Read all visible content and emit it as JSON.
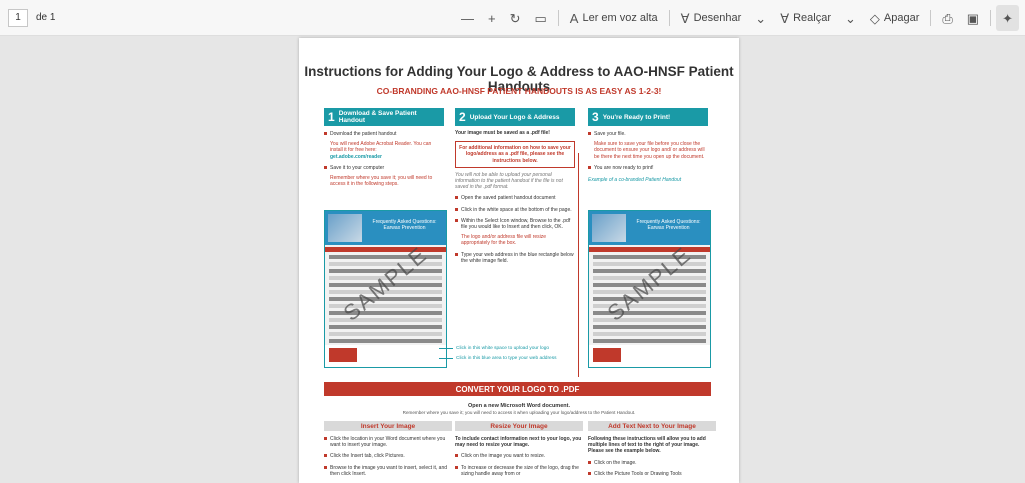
{
  "toolbar": {
    "page_number": "1",
    "page_of": "de 1",
    "read_aloud": "Ler em voz alta",
    "draw": "Desenhar",
    "highlight": "Realçar",
    "erase": "Apagar",
    "icons": [
      "zoom-out-icon",
      "zoom-in-icon",
      "rotate-icon",
      "fit-page-icon",
      "read-aloud-icon",
      "draw-icon",
      "chevron-down-icon",
      "highlight-icon",
      "eraser-icon",
      "print-icon",
      "save-icon",
      "pin-icon"
    ]
  },
  "document": {
    "title": "Instructions for Adding Your Logo & Address to AAO-HNSF Patient Handouts",
    "subtitle": "CO-BRANDING AAO-HNSF PATIENT HANDOUTS IS AS EASY AS 1-2-3!",
    "step1": {
      "num": "1",
      "title": "Download & Save Patient Handout",
      "b1": "Download the patient handout",
      "r1": "You will need Adobe Acrobat Reader. You can install it for free here:",
      "link": "get.adobe.com/reader",
      "b2": "Save it to your computer",
      "r2": "Remember where you save it; you will need to access it in the following steps."
    },
    "step2": {
      "num": "2",
      "title": "Upload Your Logo & Address",
      "must": "Your image must be saved as a .pdf file!",
      "box": "For additional information on how to save your logo/address as a .pdf file, please see the instructions below.",
      "note": "You will not be able to upload your personal information to the patient handout if the file is not saved in the .pdf format.",
      "b1": "Open the saved patient handout document",
      "b2": "Click in the white space at the bottom of the page.",
      "b3": "Within the Select Icon window, Browse to the .pdf file you would like to Insert and then click, OK.",
      "r3": "The logo and/or address file will resize appropriately for the box.",
      "b4": "Type your web address in the blue rectangle below the white image field."
    },
    "step3": {
      "num": "3",
      "title": "You're Ready to Print!",
      "b1": "Save your file.",
      "r1": "Make sure to save your file before you close the document to ensure your logo and/ or address will be there the next time you open up the document.",
      "b2": "You are now ready to print!",
      "example": "Example of a co-branded Patient Handout"
    },
    "sample_mark": "SAMPLE",
    "sample_title": "Frequently Asked Questions: Earwax Prevention",
    "callout_logo": "Click in this white space to upload your logo",
    "callout_web": "Click in this blue area to type your web address",
    "convert": "CONVERT YOUR LOGO TO .PDF",
    "open_word": "Open a new Microsoft Word document.",
    "remember": "Remember where you save it; you will need to access it when uploading your logo/address to the Patient Handout.",
    "insert": {
      "title": "Insert Your Image",
      "b1": "Click the location in your Word document where you want to insert your image.",
      "b2": "Click the Insert tab, click Pictures.",
      "b3": "Browse to the image you want to insert, select it, and then click Insert."
    },
    "resize": {
      "title": "Resize Your Image",
      "intro": "To include contact information next to your logo, you may need to resize your image.",
      "b1": "Click on the image you want to resize.",
      "b2": "To increase or decrease the size of the logo, drag the sizing handle away from or"
    },
    "addtext": {
      "title": "Add Text Next to Your Image",
      "intro": "Following these instructions will allow you to add multiple lines of text to the right of your image. Please see the example below.",
      "b1": "Click on the image.",
      "b2": "Click the Picture Tools or Drawing Tools"
    }
  }
}
